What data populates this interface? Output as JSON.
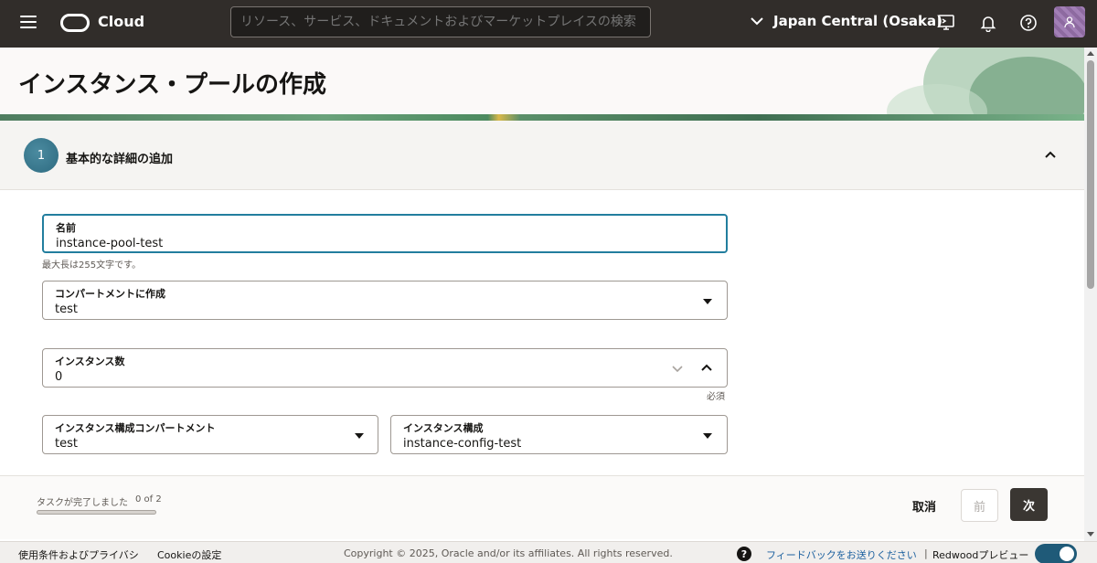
{
  "header": {
    "brand": "Cloud",
    "search_placeholder": "リソース、サービス、ドキュメントおよびマーケットプレイスの検索",
    "region": "Japan Central (Osaka)"
  },
  "page": {
    "title": "インスタンス・プールの作成"
  },
  "step": {
    "number": "1",
    "title": "基本的な詳細の追加"
  },
  "form": {
    "name": {
      "label": "名前",
      "value": "instance-pool-test",
      "helper": "最大長は255文字です。"
    },
    "compartment": {
      "label": "コンパートメントに作成",
      "value": "test"
    },
    "instance_count": {
      "label": "インスタンス数",
      "value": "0",
      "helper": "必須"
    },
    "config_compartment": {
      "label": "インスタンス構成コンパートメント",
      "value": "test"
    },
    "instance_config": {
      "label": "インスタンス構成",
      "value": "instance-config-test"
    }
  },
  "wizard_footer": {
    "progress_label": "タスクが完了しました",
    "progress_count": "0 of 2",
    "progress_fraction": 0,
    "cancel": "取消",
    "prev": "前",
    "next": "次"
  },
  "global_footer": {
    "terms": "使用条件およびプライバシ",
    "cookies": "Cookieの設定",
    "copyright": "Copyright © 2025, Oracle and/or its affiliates. All rights reserved.",
    "help_glyph": "?",
    "feedback": "フィードバックをお送りください",
    "separator": "|",
    "redwood": "Redwoodプレビュー"
  },
  "colors": {
    "topbar": "#312d2a",
    "focus": "#227e9e",
    "primary_button": "#3a3632",
    "toggle": "#1f5a78"
  },
  "icons": [
    "hamburger-icon",
    "oracle-logo-icon",
    "chevron-down-icon",
    "cloud-shell-icon",
    "bell-icon",
    "help-icon",
    "user-icon",
    "chevron-up-icon",
    "caret-down-icon"
  ]
}
